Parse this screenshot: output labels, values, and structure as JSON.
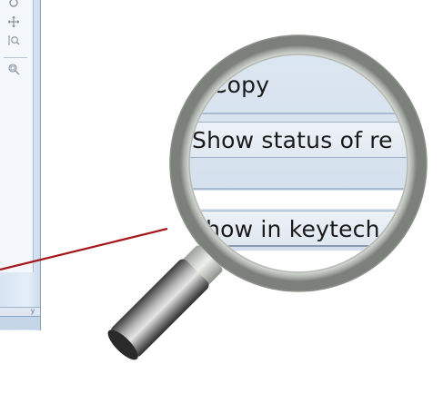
{
  "menu": {
    "items": [
      {
        "label": "Copy"
      },
      {
        "label": "Show status of re"
      },
      {
        "label": "Show in keytech"
      }
    ]
  },
  "status_bar": {
    "text": "y"
  },
  "colors": {
    "pointer_line": "#a4161a",
    "menu_bg": "#d6e2ee",
    "lens_rim": "#c8ccc6",
    "handle": "#8a8a8a"
  },
  "icons": [
    "record-icon",
    "pan-icon",
    "zoom-icon",
    "zoom-window-icon",
    "magnifier-icon"
  ]
}
